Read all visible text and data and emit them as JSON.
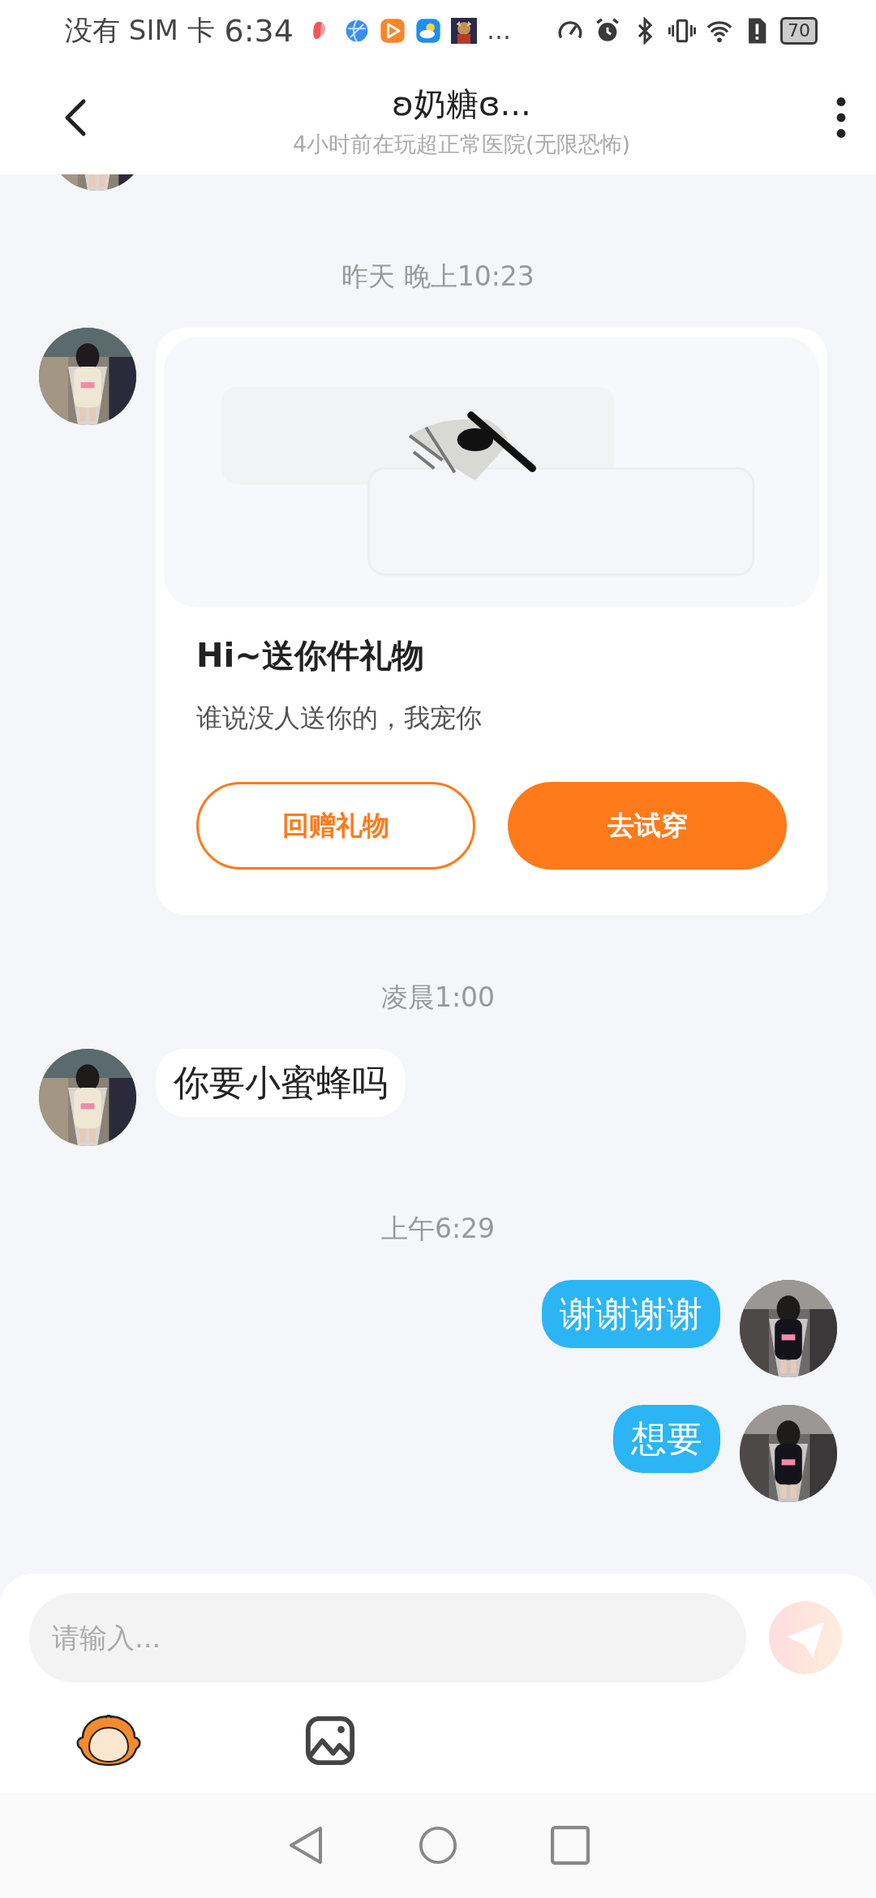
{
  "status_bar": {
    "carrier": "没有 SIM 卡",
    "time": "6:34",
    "more": "…",
    "battery": "70"
  },
  "header": {
    "title": "ʚ奶糖ɞ...",
    "subtitle": "4小时前在玩超正常医院(无限恐怖)"
  },
  "messages": [
    {
      "kind": "time",
      "text": "昨天 晚上10:23"
    },
    {
      "kind": "gift",
      "mine": false,
      "title": "Hi~送你件礼物",
      "text": "谁说没人送你的，我宠你",
      "buttons": [
        {
          "label": "回赠礼物",
          "primary": false
        },
        {
          "label": "去试穿",
          "primary": true
        }
      ]
    },
    {
      "kind": "time",
      "text": "凌晨1:00"
    },
    {
      "kind": "text",
      "mine": false,
      "text": "你要小蜜蜂吗"
    },
    {
      "kind": "time",
      "text": "上午6:29"
    },
    {
      "kind": "text",
      "mine": true,
      "text": "谢谢谢谢"
    },
    {
      "kind": "text",
      "mine": true,
      "text": "想要"
    }
  ],
  "composer": {
    "placeholder": "请输入...",
    "send_disabled": true
  }
}
